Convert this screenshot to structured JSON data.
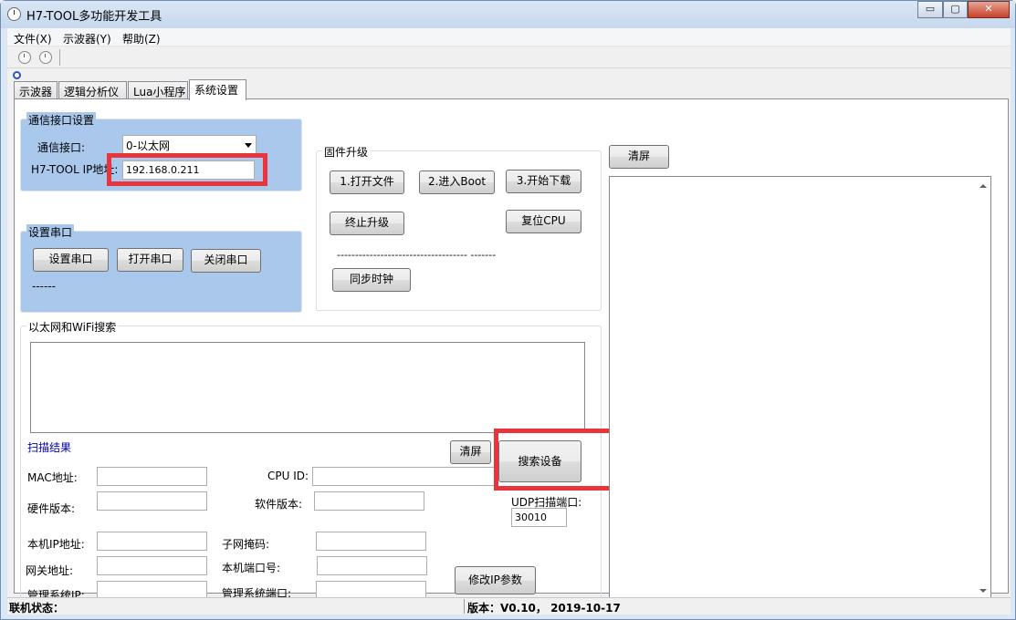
{
  "window": {
    "title": "H7-TOOL多功能开发工具",
    "controls": {
      "minimize": "▭",
      "maximize": "▢",
      "close": "✕"
    }
  },
  "menu": [
    "文件(X)",
    "示波器(Y)",
    "帮助(Z)"
  ],
  "toolbar_icons": [
    "clock-icon",
    "clock-icon"
  ],
  "tabs": [
    {
      "label": "示波器",
      "active": false
    },
    {
      "label": "逻辑分析仪",
      "active": false
    },
    {
      "label": "Lua小程序",
      "active": false
    },
    {
      "label": "系统设置",
      "active": true
    }
  ],
  "comm": {
    "title": "通信接口设置",
    "interface_label": "通信接口:",
    "interface_value": "0-以太网",
    "ip_label": "H7-TOOL IP地址:",
    "ip_value": "192.168.0.211"
  },
  "serial": {
    "title": "设置串口",
    "buttons": [
      "设置串口",
      "打开串口",
      "关闭串口"
    ],
    "status": "------"
  },
  "firmware": {
    "title": "固件升级",
    "open_file": "1.打开文件",
    "enter_boot": "2.进入Boot",
    "start_download": "3.开始下载",
    "stop_upgrade": "终止升级",
    "reset_cpu": "复位CPU",
    "progress_text": "------------------------------------   -------",
    "sync_clock": "同步时钟"
  },
  "search": {
    "title": "以太网和WiFi搜索",
    "result_title": "扫描结果",
    "clear_label": "清屏",
    "search_button": "搜索设备",
    "udp_label": "UDP扫描端口:",
    "udp_value": "30010",
    "mac_label": "MAC地址:",
    "cpu_id_label": "CPU ID:",
    "hw_version_label": "硬件版本:",
    "sw_version_label": "软件版本:",
    "local_ip_label": "本机IP地址:",
    "subnet_label": "子网掩码:",
    "gateway_label": "网关地址:",
    "local_port_label": "本机端口号:",
    "mgmt_ip_label": "管理系统IP:",
    "mgmt_port_label": "管理系统端口:",
    "modify_ip_button": "修改IP参数"
  },
  "log": {
    "clear_label": "清屏"
  },
  "status": {
    "online_label": "联机状态：",
    "version_text": "版本：V0.10， 2019-10-17"
  },
  "colors": {
    "highlight_red": "#e8343b",
    "group_blue": "#a9c8ec",
    "result_title_blue": "#0000a0"
  }
}
